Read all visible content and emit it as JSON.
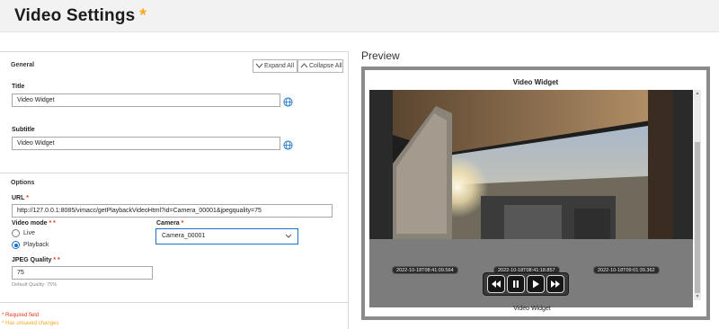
{
  "header": {
    "title": "Video Settings",
    "unsaved_marker": "*"
  },
  "general": {
    "section_label": "General",
    "expand_all": "Expand All",
    "collapse_all": "Collapse All",
    "title_label": "Title",
    "title_value": "Video Widget",
    "subtitle_label": "Subtitle",
    "subtitle_value": "Video Widget"
  },
  "options": {
    "section_label": "Options",
    "url_label": "URL",
    "url_required": "*",
    "url_value": "http://127.0.0.1:8085/vimacc/getPlaybackVideoHtml?id=Camera_00001&jpegquality=75",
    "video_mode_label": "Video mode",
    "video_mode_required": "* *",
    "mode_live": "Live",
    "mode_playback": "Playback",
    "selected_mode": "Playback",
    "camera_label": "Camera",
    "camera_required": "*",
    "camera_value": "Camera_00001",
    "jpeg_label": "JPEG Quality",
    "jpeg_required": "* *",
    "jpeg_value": "75",
    "jpeg_hint": "Default Quality: 75%"
  },
  "footer": {
    "required_note": "* Required field",
    "unsaved_note": "* Has unsaved changes"
  },
  "preview": {
    "title": "Preview",
    "widget_title": "Video Widget",
    "widget_footer": "Video Widget",
    "timestamps": [
      "2022-10-18T08:41:09.564",
      "2022-10-18T08:41:18.857",
      "2022-10-18T09:01:39.362"
    ]
  },
  "icons": {
    "globe": "globe-icon",
    "expand": "chevron-down-icon",
    "collapse": "chevron-up-icon",
    "dropdown": "chevron-down-icon",
    "rewind": "rewind-icon",
    "pause": "pause-icon",
    "play": "play-icon",
    "fast_forward": "fast-forward-icon"
  },
  "colors": {
    "accent": "#1a73c9",
    "required": "#e2361c",
    "unsaved": "#f5a623"
  }
}
